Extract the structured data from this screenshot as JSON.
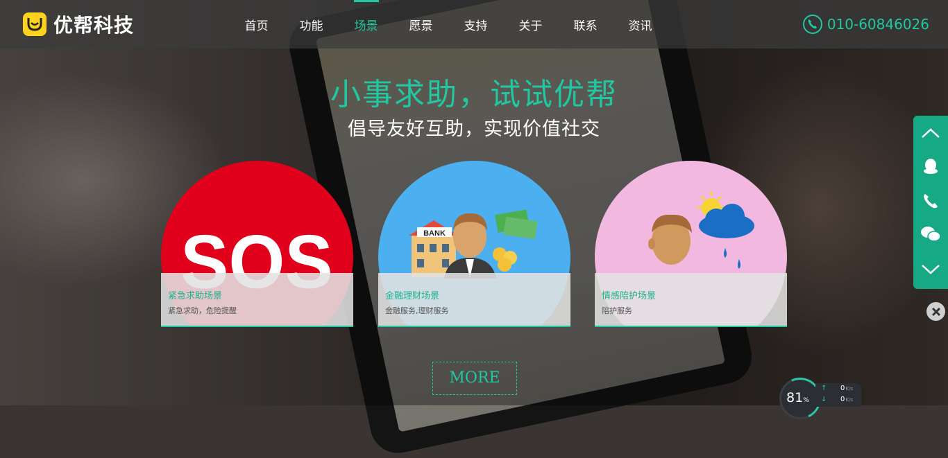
{
  "header": {
    "logo_text": "优帮科技",
    "nav": [
      {
        "label": "首页",
        "active": false
      },
      {
        "label": "功能",
        "active": false
      },
      {
        "label": "场景",
        "active": true
      },
      {
        "label": "愿景",
        "active": false
      },
      {
        "label": "支持",
        "active": false
      },
      {
        "label": "关于",
        "active": false
      },
      {
        "label": "联系",
        "active": false
      },
      {
        "label": "资讯",
        "active": false
      }
    ],
    "phone": "010-60846026"
  },
  "hero": {
    "title": "小事求助，试试优帮",
    "subtitle": "倡导友好互助，实现价值社交"
  },
  "cards": [
    {
      "title": "紧急求助场景",
      "desc": "紧急求助，危险提醒",
      "bg": "#e0001b",
      "art_text": "SOS"
    },
    {
      "title": "金融理财场景",
      "desc": "金融服务,理财服务",
      "bg": "#4cb0f0",
      "art_text": "BANK"
    },
    {
      "title": "情感陪护场景",
      "desc": "陪护服务",
      "bg": "#f2b8df"
    }
  ],
  "more_label": "MORE",
  "sidebar": {
    "items": [
      "chevron-up-icon",
      "qq-icon",
      "phone-icon",
      "wechat-icon",
      "chevron-down-icon"
    ]
  },
  "speed_widget": {
    "percent": "81",
    "percent_unit": "%",
    "up": "0",
    "down": "0",
    "unit": "K/s"
  },
  "colors": {
    "accent": "#20c9a0",
    "logo": "#ffd21f",
    "sidebar": "#17a886"
  }
}
